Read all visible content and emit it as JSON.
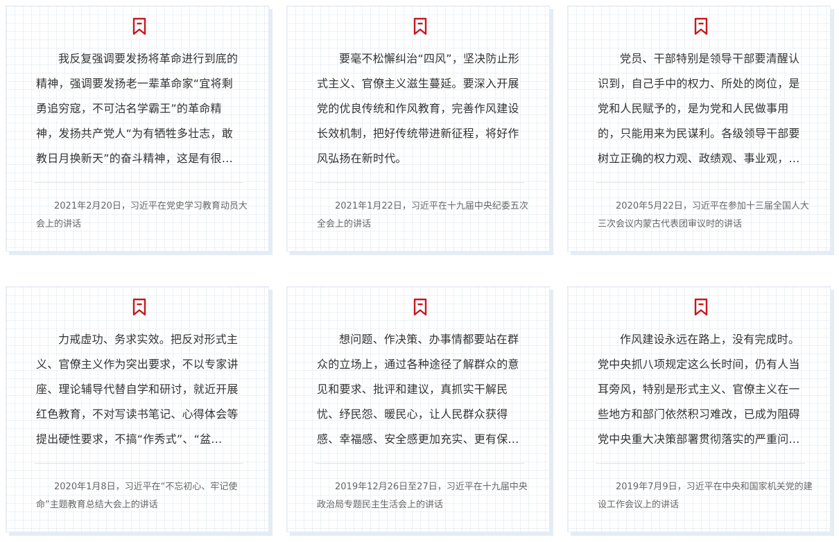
{
  "colors": {
    "accent": "#c8161d",
    "text": "#333333",
    "muted": "#666666",
    "divider": "#e2e2e2"
  },
  "cards": [
    {
      "icon": "bookmark-icon",
      "quote": "我反复强调要发扬将革命进行到底的精神，强调要发扬老一辈革命家“宜将剩勇追穷寇，不可沽名学霸王”的革命精神，发扬共产党人“为有牺牲多壮志，敢教日月换新天”的奋斗精神，这是有很…",
      "source": "2021年2月20日，习近平在党史学习教育动员大会上的讲话"
    },
    {
      "icon": "bookmark-icon",
      "quote": "要毫不松懈纠治“四风”，坚决防止形式主义、官僚主义滋生蔓延。要深入开展党的优良传统和作风教育，完善作风建设长效机制，把好传统带进新征程，将好作风弘扬在新时代。",
      "source": "2021年1月22日，习近平在十九届中央纪委五次全会上的讲话"
    },
    {
      "icon": "bookmark-icon",
      "quote": "党员、干部特别是领导干部要清醒认识到，自己手中的权力、所处的岗位，是党和人民赋予的，是为党和人民做事用的，只能用来为民谋利。各级领导干部要树立正确的权力观、政绩观、事业观，…",
      "source": "2020年5月22日，习近平在参加十三届全国人大三次会议内蒙古代表团审议时的讲话"
    },
    {
      "icon": "bookmark-icon",
      "quote": "力戒虚功、务求实效。把反对形式主义、官僚主义作为突出要求，不以专家讲座、理论辅导代替自学和研讨，就近开展红色教育，不对写读书笔记、心得体会等提出硬性要求，不搞“作秀式”、“盆…",
      "source": "2020年1月8日，习近平在“不忘初心、牢记使命”主题教育总结大会上的讲话"
    },
    {
      "icon": "bookmark-icon",
      "quote": "想问题、作决策、办事情都要站在群众的立场上，通过各种途径了解群众的意见和要求、批评和建议，真抓实干解民忧、纾民怨、暖民心，让人民群众获得感、幸福感、安全感更加充实、更有保…",
      "source": "2019年12月26日至27日，习近平在十九届中央政治局专题民主生活会上的讲话"
    },
    {
      "icon": "bookmark-icon",
      "quote": "作风建设永远在路上，没有完成时。党中央抓八项规定这么长时间，仍有人当耳旁风，特别是形式主义、官僚主义在一些地方和部门依然积习难改，已成为阻碍党中央重大决策部署贯彻落实的严重问…",
      "source": "2019年7月9日，习近平在中央和国家机关党的建设工作会议上的讲话"
    }
  ]
}
